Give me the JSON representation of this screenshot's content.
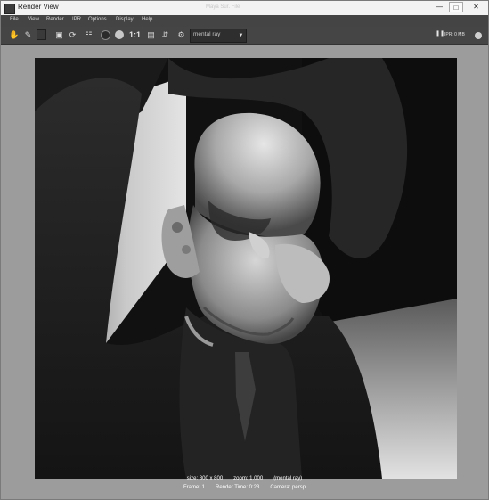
{
  "window": {
    "title": "Render View",
    "faint_title": "Maya Sur. File"
  },
  "menu": [
    "File",
    "View",
    "Render",
    "IPR",
    "Options",
    "Display",
    "Help"
  ],
  "toolbar": {
    "icons": [
      "redo-previous-render-icon",
      "render-region-icon",
      "snapshot-icon",
      "render-ipr-icon",
      "refresh-ipr-icon",
      "render-settings-icon",
      "display-rgb-icon",
      "display-alpha-icon",
      "real-size-icon",
      "keep-image-icon",
      "remove-image-icon",
      "camera-select-icon"
    ],
    "ratio_label": "1:1",
    "renderer": "mental ray",
    "ipr_label": "IPR:",
    "ipr_value": "0 MB"
  },
  "render_info": {
    "size": "size: 800 x 800",
    "zoom": "zoom: 1.000",
    "renderer": "(mental ray)",
    "frame": "Frame: 1",
    "render_time": "Render Time: 0:23",
    "camera": "Camera: persp"
  }
}
